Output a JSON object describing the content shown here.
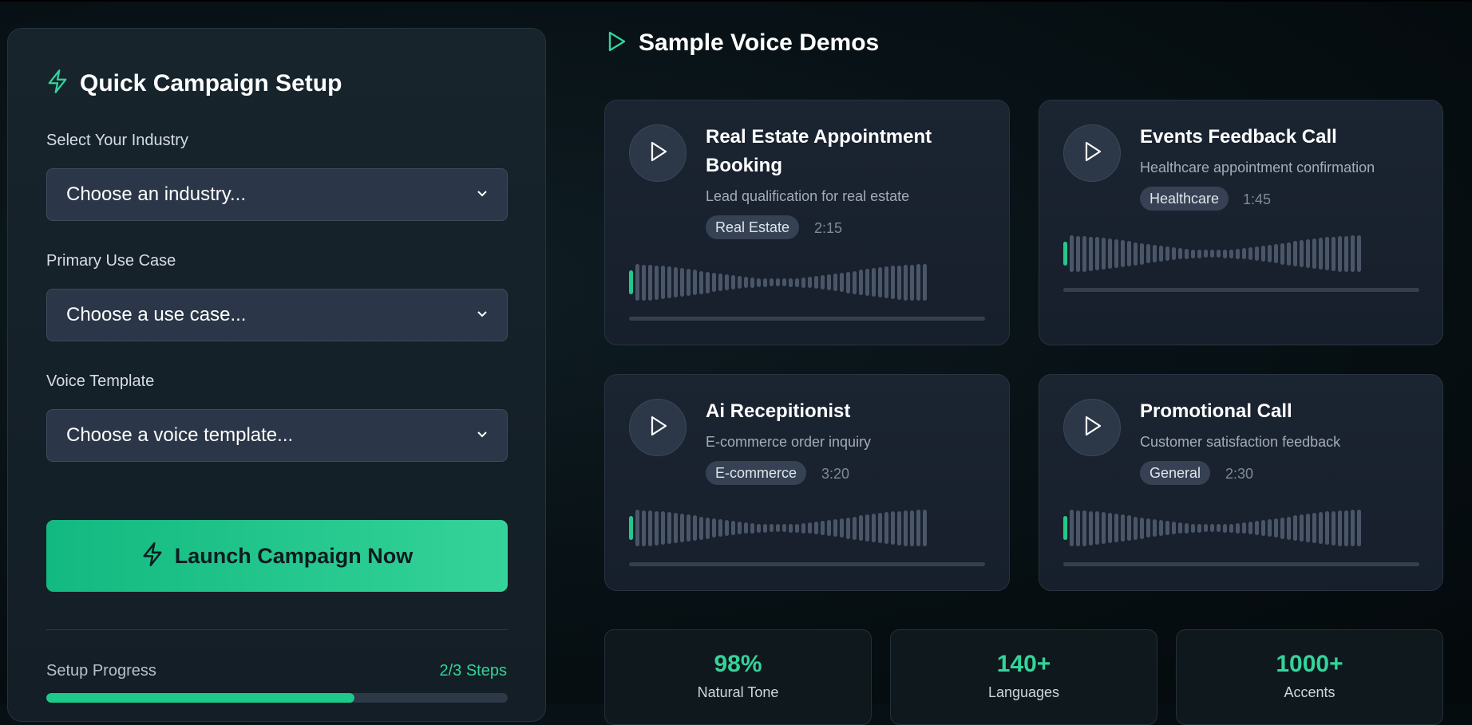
{
  "setup": {
    "title": "Quick Campaign Setup",
    "industry_label": "Select Your Industry",
    "industry_value": "Choose an industry...",
    "usecase_label": "Primary Use Case",
    "usecase_value": "Choose a use case...",
    "template_label": "Voice Template",
    "template_value": "Choose a voice template...",
    "launch_label": "Launch Campaign Now",
    "progress_label": "Setup Progress",
    "progress_steps": "2/3 Steps",
    "progress_fraction": 0.667
  },
  "demos": {
    "title": "Sample Voice Demos",
    "cards": [
      {
        "title_line1": "Real Estate Appointment",
        "title_line2": "Booking",
        "subtitle": "Lead qualification for real estate",
        "tag": "Real Estate",
        "duration": "2:15"
      },
      {
        "title_line1": "Events Feedback Call",
        "subtitle": "Healthcare appointment confirmation",
        "tag": "Healthcare",
        "duration": "1:45"
      },
      {
        "title_line1": "Ai Recepitionist",
        "subtitle": "E-commerce order inquiry",
        "tag": "E-commerce",
        "duration": "3:20"
      },
      {
        "title_line1": "Promotional Call",
        "subtitle": "Customer satisfaction feedback",
        "tag": "General",
        "duration": "2:30"
      }
    ]
  },
  "stats": [
    {
      "value": "98%",
      "label": "Natural Tone"
    },
    {
      "value": "140+",
      "label": "Languages"
    },
    {
      "value": "1000+",
      "label": "Accents"
    }
  ],
  "colors": {
    "accent": "#34d399",
    "accent_dark": "#12b980",
    "card_bg": "#1b2431",
    "page_bg": "#071014"
  },
  "icons": {
    "setup": "lightning-icon",
    "demos": "play-outline-icon",
    "launch": "lightning-icon",
    "card": "play-icon",
    "select": "chevron-down-icon"
  }
}
